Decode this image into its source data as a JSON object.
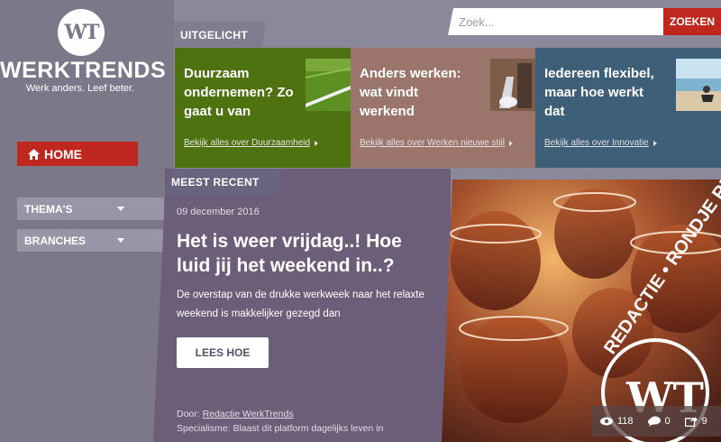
{
  "brand": {
    "logo_text": "WT",
    "name": "WERKTRENDS",
    "tagline": "Werk anders. Leef beter."
  },
  "sidebar": {
    "home_label": "HOME",
    "dropdowns": [
      {
        "label": "THEMA'S"
      },
      {
        "label": "BRANCHES"
      }
    ]
  },
  "search": {
    "placeholder": "Zoek...",
    "button_label": "ZOEKEN"
  },
  "featured": {
    "section_label": "UITGELICHT",
    "items": [
      {
        "title": "Duurzaam ondernemen? Zo gaat u van",
        "link": "Bekijk alles over Duurzaamheid",
        "color": "#4f7211"
      },
      {
        "title": "Anders werken: wat vindt werkend",
        "link": "Bekijk alles over Werken nieuwe stijl",
        "color": "#9b756c"
      },
      {
        "title": "Iedereen flexibel, maar hoe werkt dat",
        "link": "Bekijk alles over Innovatie",
        "color": "#3d5f77"
      }
    ]
  },
  "recent": {
    "section_label": "MEEST RECENT",
    "date": "09 december 2016",
    "headline": "Het is weer vrijdag..! Hoe luid jij het weekend in..?",
    "lead": "De overstap van de drukke werkweek naar het relaxte weekend is makkelijker gezegd dan",
    "button_label": "LEES HOE",
    "author_prefix": "Door:",
    "author": "Redactie WerkTrends",
    "specialism": "Specialisme: Blaast dit platform dagelijks leven in",
    "stamp_text": "REDACTIE • RONDJE RE",
    "stamp_logo": "WT",
    "stats": {
      "views": "118",
      "comments": "0",
      "shares": "9"
    }
  },
  "colors": {
    "accent": "#c0271f",
    "sidebar": "#7a7889",
    "recent_bg": "#6c5e78"
  }
}
